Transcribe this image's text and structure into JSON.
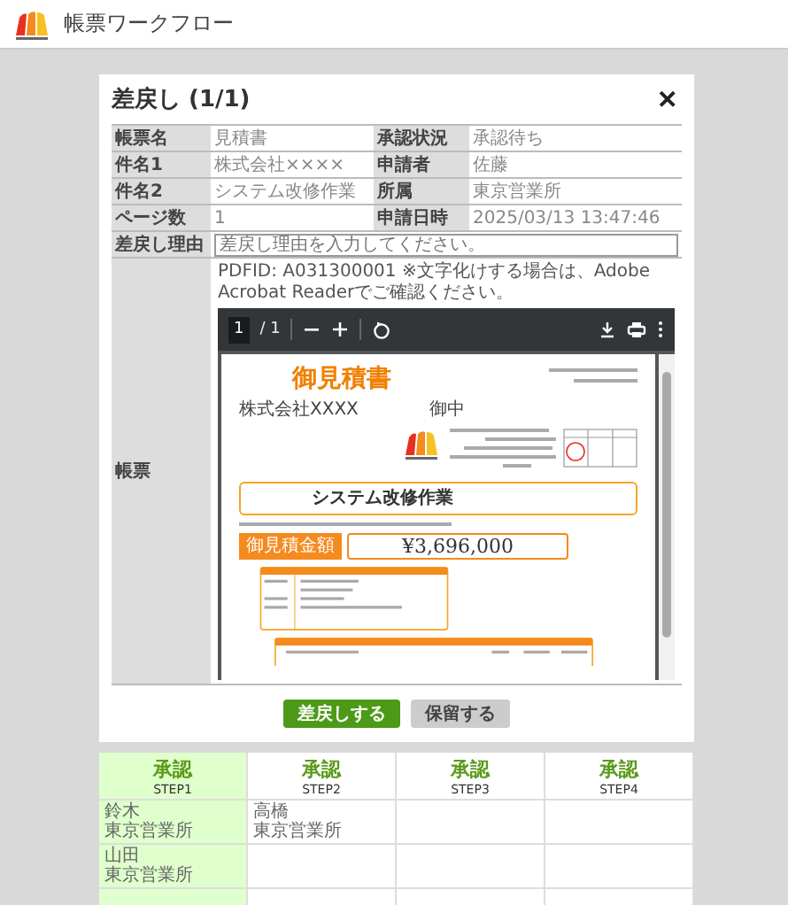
{
  "app": {
    "title": "帳票ワークフロー"
  },
  "dialog": {
    "title": "差戻し (1/1)",
    "close": "✕",
    "rows": [
      [
        {
          "label": "帳票名",
          "value": "見積書"
        },
        {
          "label": "承認状況",
          "value": "承認待ち"
        }
      ],
      [
        {
          "label": "件名1",
          "value": "株式会社××××"
        },
        {
          "label": "申請者",
          "value": "佐藤"
        }
      ],
      [
        {
          "label": "件名2",
          "value": "システム改修作業"
        },
        {
          "label": "所属",
          "value": "東京営業所"
        }
      ],
      [
        {
          "label": "ページ数",
          "value": "1"
        },
        {
          "label": "申請日時",
          "value": "2025/03/13 13:47:46"
        }
      ]
    ],
    "reason": {
      "label": "差戻し理由",
      "placeholder": "差戻し理由を入力してください。"
    },
    "document": {
      "label": "帳票",
      "note": "PDFID: A031300001 ※文字化けする場合は、Adobe Acrobat Readerでご確認ください。",
      "viewer": {
        "page": "1",
        "total": "/ 1"
      },
      "pdf": {
        "title": "御見積書",
        "customer": "株式会社XXXX",
        "honorific": "御中",
        "subject": "システム改修作業",
        "amount_label": "御見積金額",
        "amount": "¥3,696,000"
      }
    },
    "buttons": [
      {
        "label": "差戻しする",
        "kind": "primary"
      },
      {
        "label": "保留する",
        "kind": "secondary"
      }
    ]
  },
  "steps": [
    {
      "status": "承認",
      "step": "STEP1",
      "current": true,
      "approvers": [
        {
          "name": "鈴木",
          "office": "東京営業所"
        },
        {
          "name": "山田",
          "office": "東京営業所"
        }
      ]
    },
    {
      "status": "承認",
      "step": "STEP2",
      "current": false,
      "approvers": [
        {
          "name": "高橋",
          "office": "東京営業所"
        }
      ]
    },
    {
      "status": "承認",
      "step": "STEP3",
      "current": false
    },
    {
      "status": "承認",
      "step": "STEP4",
      "current": false
    }
  ]
}
